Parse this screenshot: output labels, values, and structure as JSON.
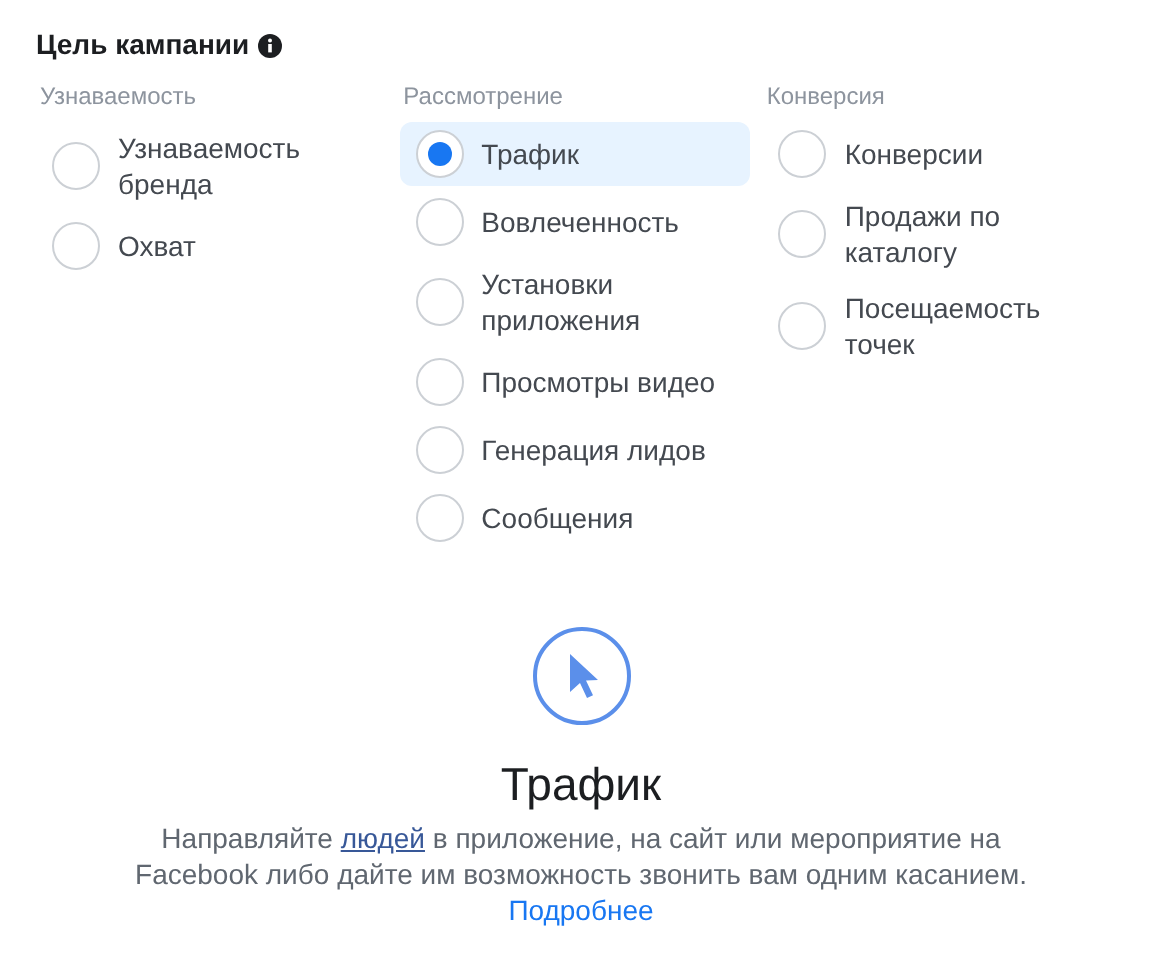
{
  "title": "Цель кампании",
  "groups": [
    {
      "title": "Узнаваемость",
      "options": [
        {
          "label": "Узнаваемость бренда",
          "selected": false
        },
        {
          "label": "Охват",
          "selected": false
        }
      ]
    },
    {
      "title": "Рассмотрение",
      "options": [
        {
          "label": "Трафик",
          "selected": true
        },
        {
          "label": "Вовлеченность",
          "selected": false
        },
        {
          "label": "Установки приложения",
          "selected": false
        },
        {
          "label": "Просмотры видео",
          "selected": false
        },
        {
          "label": "Генерация лидов",
          "selected": false
        },
        {
          "label": "Сообщения",
          "selected": false
        }
      ]
    },
    {
      "title": "Конверсия",
      "options": [
        {
          "label": "Конверсии",
          "selected": false
        },
        {
          "label": "Продажи по каталогу",
          "selected": false
        },
        {
          "label": "Посещаемость точек",
          "selected": false
        }
      ]
    }
  ],
  "detail": {
    "title": "Трафик",
    "text_before": "Направляйте ",
    "term": "людей",
    "text_after": " в приложение, на сайт или мероприятие на Facebook либо дайте им возможность звонить вам одним касанием. ",
    "link": "Подробнее"
  }
}
